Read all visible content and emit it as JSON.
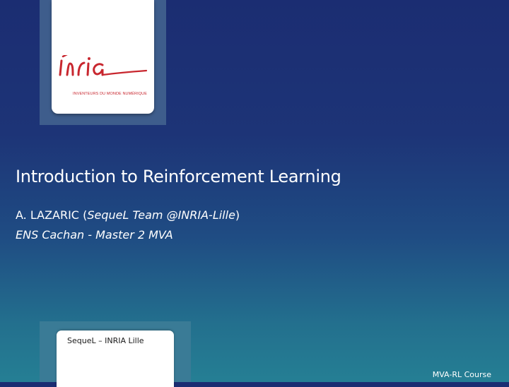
{
  "logo": {
    "wordmark": "Inria",
    "tagline": "INVENTEURS DU MONDE NUMÉRIQUE",
    "color": "#c8272f"
  },
  "slide": {
    "title": "Introduction to Reinforcement Learning",
    "author": {
      "name": "A. LAZARIC (",
      "affiliation": "SequeL Team @INRIA-Lille",
      "close": ")"
    },
    "institute": "ENS Cachan - Master 2 MVA"
  },
  "footer": {
    "lab_label": "SequeL – INRIA Lille",
    "course": "MVA-RL Course"
  },
  "colors": {
    "background_top": "#1b2d72",
    "background_bottom": "#257f94",
    "text": "#ffffff"
  }
}
